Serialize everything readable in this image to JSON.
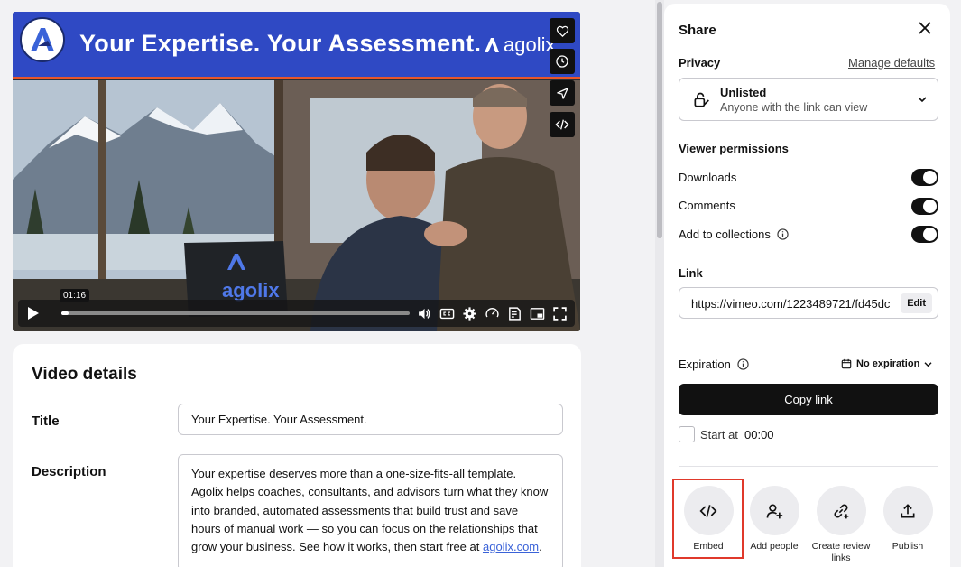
{
  "player": {
    "banner_title": "Your Expertise. Your Assessment.",
    "banner_brand": "agolix",
    "screen_brand": "agolix",
    "time_tooltip": "01:16",
    "progress_fraction": 0.02,
    "side_buttons": [
      "heart-icon",
      "clock-icon",
      "send-icon",
      "code-icon"
    ],
    "control_icons": [
      "volume-icon",
      "captions-icon",
      "settings-icon",
      "speed-icon",
      "transcript-icon",
      "pip-icon",
      "fullscreen-icon"
    ]
  },
  "details": {
    "heading": "Video details",
    "title_label": "Title",
    "title_value": "Your Expertise. Your Assessment.",
    "description_label": "Description",
    "description_text": "Your expertise deserves more than a one-size-fits-all template. Agolix helps coaches, consultants, and advisors turn what they know into branded, automated assessments that build trust and save hours of manual work — so you can focus on the relationships that grow your business. See how it works, then start free at ",
    "description_link": "agolix.com",
    "description_end": "."
  },
  "share": {
    "title": "Share",
    "privacy_label": "Privacy",
    "manage_defaults": "Manage defaults",
    "privacy_value": "Unlisted",
    "privacy_sub": "Anyone with the link can view",
    "viewer_permissions_label": "Viewer permissions",
    "permissions": [
      {
        "label": "Downloads",
        "enabled": true
      },
      {
        "label": "Comments",
        "enabled": true
      },
      {
        "label": "Add to collections",
        "enabled": true
      }
    ],
    "link_label": "Link",
    "link_value": "https://vimeo.com/1223489721/fd45dc",
    "edit_label": "Edit",
    "expiration_label": "Expiration",
    "expiration_value": "No expiration",
    "copy_link_label": "Copy link",
    "start_at_label": "Start at",
    "start_at_value": "00:00",
    "actions": [
      {
        "label": "Embed",
        "icon": "code-icon"
      },
      {
        "label": "Add people",
        "icon": "add-person-icon"
      },
      {
        "label": "Create review links",
        "icon": "link-plus-icon"
      },
      {
        "label": "Publish",
        "icon": "upload-icon"
      }
    ]
  },
  "colors": {
    "banner_blue": "#2f49c4",
    "banner_accent": "#e8562a",
    "highlight_red": "#e0392b",
    "button_dark": "#111111",
    "link_blue": "#3a62d8"
  }
}
